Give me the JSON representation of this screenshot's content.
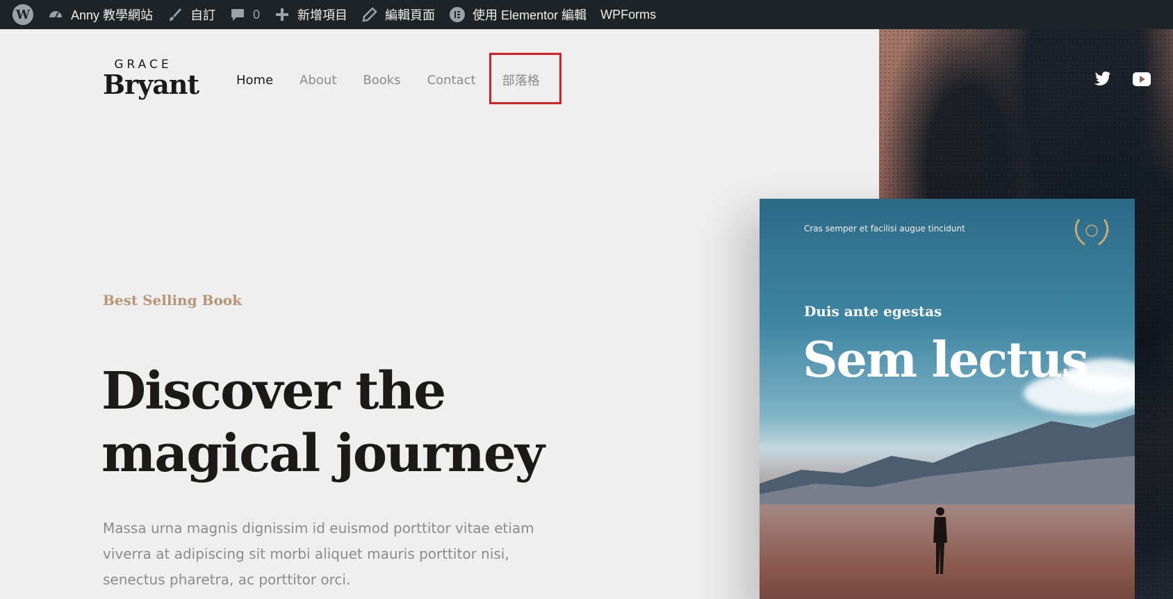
{
  "admin_bar": {
    "site_name": "Anny 教學網站",
    "customize": "自訂",
    "comments_count": "0",
    "new_item": "新增項目",
    "edit_page": "編輯頁面",
    "elementor": "使用 Elementor 編輯",
    "wpforms": "WPForms"
  },
  "header": {
    "logo_small": "GRACE",
    "logo_big": "Bryant",
    "nav": [
      "Home",
      "About",
      "Books",
      "Contact",
      "部落格"
    ],
    "active_nav": "Home",
    "highlighted_nav": "部落格"
  },
  "hero": {
    "eyebrow": "Best Selling Book",
    "headline_line1": "Discover the",
    "headline_line2": "magical journey",
    "lead": "Massa urna magnis dignissim id euismod porttitor vitae etiam viverra at adipiscing sit morbi aliquet mauris porttitor nisi, senectus pharetra, ac porttitor orci."
  },
  "book": {
    "tagline": "Cras semper et facilisi augue tincidunt",
    "subtitle": "Duis ante egestas",
    "title": "Sem lectus"
  },
  "colors": {
    "admin_bar": "#1d2327",
    "page_bg": "#efefef",
    "accent": "#b89574",
    "highlight": "#e01b22",
    "headline": "#1c1a16"
  },
  "icons": {
    "social": [
      "twitter-icon",
      "youtube-icon"
    ]
  }
}
